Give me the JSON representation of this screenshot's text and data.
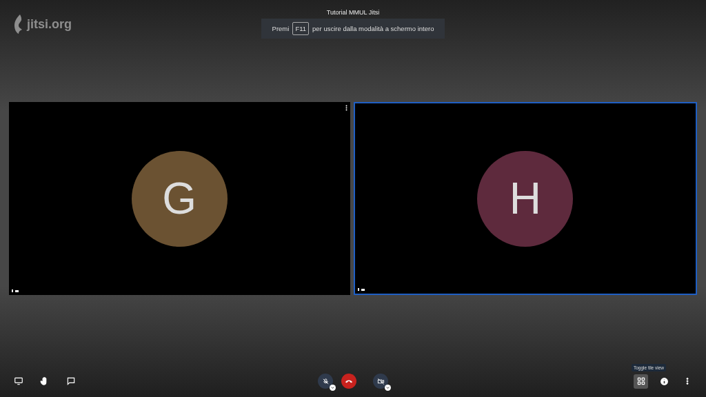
{
  "logo": {
    "text": "jitsi.org"
  },
  "meeting_title": "Tutorial MMUL Jitsi",
  "fullscreen_notice": {
    "before": "Premi",
    "key": "F11",
    "after": "per uscire dalla modalità a schermo intero"
  },
  "tiles": [
    {
      "initial": "G",
      "color": "#6b5232",
      "selected": false,
      "menu_visible": true
    },
    {
      "initial": "H",
      "color": "#5e2a3d",
      "selected": true,
      "menu_visible": false
    }
  ],
  "toolbar": {
    "tooltip": "Toggle tile view"
  }
}
